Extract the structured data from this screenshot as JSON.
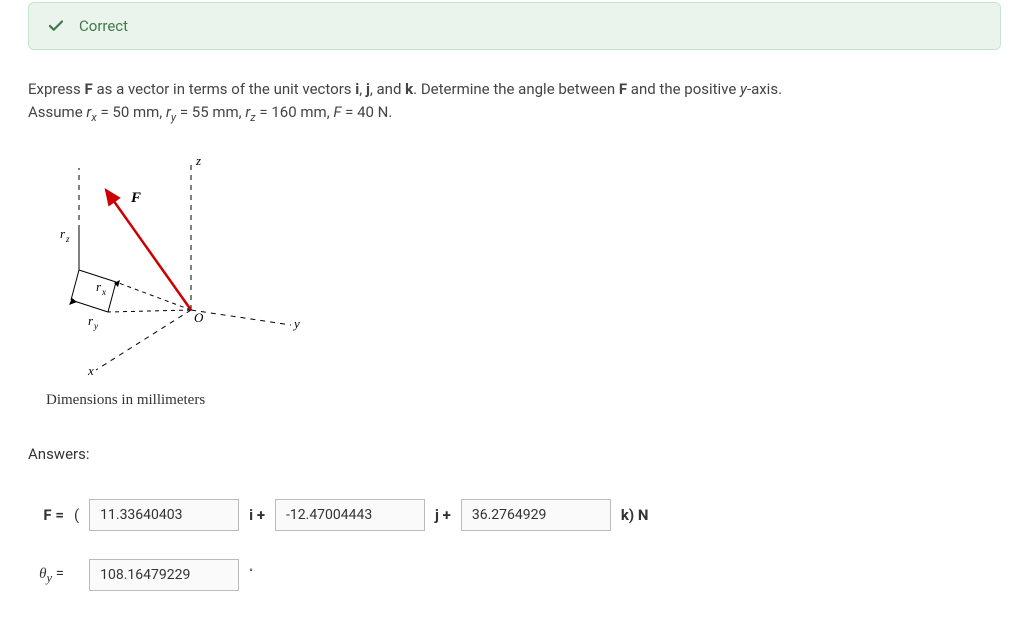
{
  "status": {
    "label": "Correct",
    "color": "#3f7a4a"
  },
  "question": {
    "line1_pre": "Express ",
    "line1_bold": "F",
    "line1_mid": " as a vector in terms of the unit vectors ",
    "line1_i": "i",
    "line1_j": "j",
    "line1_and": ", and ",
    "line1_k": "k",
    "line1_post": ". Determine the angle between ",
    "line1_bold2": "F",
    "line1_end": " and the positive ",
    "line1_yax": "y",
    "line1_end2": "-axis.",
    "line2_pre": "Assume ",
    "rx_label": "r",
    "rx_sub": "x",
    "rx_val": " = 50 mm, ",
    "ry_label": "r",
    "ry_sub": "y",
    "ry_val": " = 55 mm, ",
    "rz_label": "r",
    "rz_sub": "z",
    "rz_val": " = 160 mm, ",
    "F_label": "F",
    "F_val": " = 40 N."
  },
  "diagram": {
    "caption": "Dimensions in millimeters",
    "labels": {
      "F": "F",
      "rx": "r",
      "rx_sub": "x",
      "ry": "r",
      "ry_sub": "y",
      "rz": "r",
      "rz_sub": "z",
      "x": "x",
      "y": "y",
      "z": "z",
      "O": "O"
    }
  },
  "answers": {
    "heading": "Answers:",
    "F_label": "F =",
    "paren_open": "(",
    "val_i": "11.33640403",
    "i_plus": "i +",
    "val_j": "-12.47004443",
    "j_plus": "j +",
    "val_k": "36.2764929",
    "k_unit": "k) N",
    "theta_label": "θ",
    "theta_sub": "y",
    "theta_eq": " =",
    "val_theta": "108.16479229",
    "degree": "°"
  }
}
